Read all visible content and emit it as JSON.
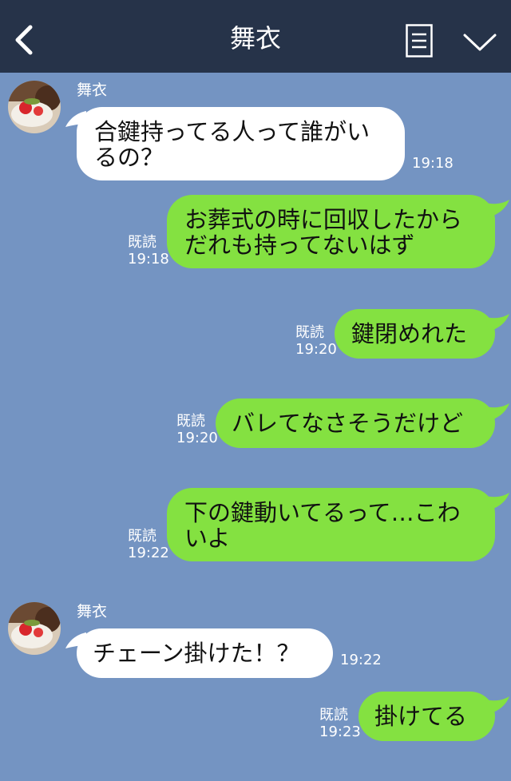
{
  "header": {
    "title": "舞衣"
  },
  "messages": [
    {
      "from": "them",
      "sender": "舞衣",
      "text": "合鍵持ってる人って誰がい\nるの？",
      "time": "19:18"
    },
    {
      "from": "me",
      "read": "既読",
      "text": "お葬式の時に回収したから\nだれも持ってないはず",
      "time": "19:18"
    },
    {
      "from": "me",
      "read": "既読",
      "text": "鍵閉めれた",
      "time": "19:20"
    },
    {
      "from": "me",
      "read": "既読",
      "text": "バレてなさそうだけど",
      "time": "19:20"
    },
    {
      "from": "me",
      "read": "既読",
      "text": "下の鍵動いてるって…こわ\nいよ",
      "time": "19:22"
    },
    {
      "from": "them",
      "sender": "舞衣",
      "text": "チェーン掛けた！？",
      "time": "19:22"
    },
    {
      "from": "me",
      "read": "既読",
      "text": "掛けてる",
      "time": "19:23"
    }
  ],
  "colors": {
    "background": "#7494c2",
    "header": "#263349",
    "bubble_mine": "#84e141",
    "bubble_theirs": "#ffffff"
  }
}
